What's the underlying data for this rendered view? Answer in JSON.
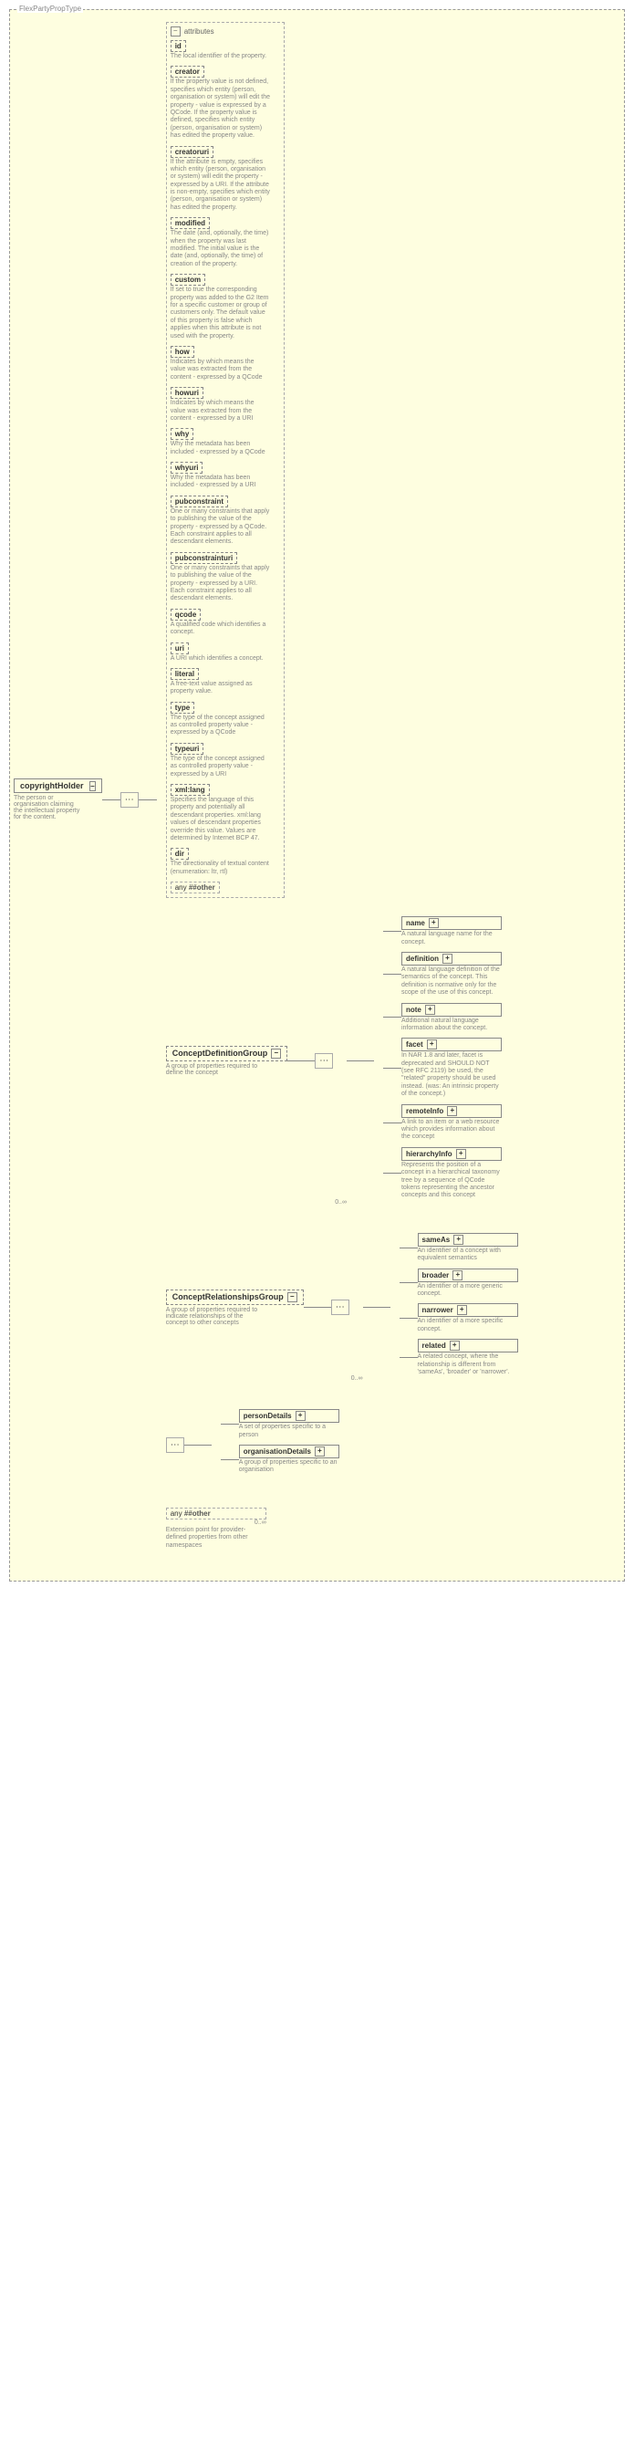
{
  "type_name": "FlexPartyPropType",
  "root": {
    "name": "copyrightHolder",
    "desc": "The person or organisation claiming the intellectual property for the content."
  },
  "attributes_label": "attributes",
  "attributes": [
    {
      "name": "id",
      "desc": "The local identifier of the property."
    },
    {
      "name": "creator",
      "desc": "If the property value is not defined, specifies which entity (person, organisation or system) will edit the property - value is expressed by a QCode. If the property value is defined, specifies which entity (person, organisation or system) has edited the property value."
    },
    {
      "name": "creatoruri",
      "desc": "If the attribute is empty, specifies which entity (person, organisation or system) will edit the property - expressed by a URI. If the attribute is non-empty, specifies which entity (person, organisation or system) has edited the property."
    },
    {
      "name": "modified",
      "desc": "The date (and, optionally, the time) when the property was last modified. The initial value is the date (and, optionally, the time) of creation of the property."
    },
    {
      "name": "custom",
      "desc": "If set to true the corresponding property was added to the G2 Item for a specific customer or group of customers only. The default value of this property is false which applies when this attribute is not used with the property."
    },
    {
      "name": "how",
      "desc": "Indicates by which means the value was extracted from the content - expressed by a QCode"
    },
    {
      "name": "howuri",
      "desc": "Indicates by which means the value was extracted from the content - expressed by a URI"
    },
    {
      "name": "why",
      "desc": "Why the metadata has been included - expressed by a QCode"
    },
    {
      "name": "whyuri",
      "desc": "Why the metadata has been included - expressed by a URI"
    },
    {
      "name": "pubconstraint",
      "desc": "One or many constraints that apply to publishing the value of the property - expressed by a QCode. Each constraint applies to all descendant elements."
    },
    {
      "name": "pubconstrainturi",
      "desc": "One or many constraints that apply to publishing the value of the property - expressed by a URI. Each constraint applies to all descendant elements."
    },
    {
      "name": "qcode",
      "desc": "A qualified code which identifies a concept."
    },
    {
      "name": "uri",
      "desc": "A URI which identifies a concept."
    },
    {
      "name": "literal",
      "desc": "A free-text value assigned as property value."
    },
    {
      "name": "type",
      "desc": "The type of the concept assigned as controlled property value - expressed by a QCode"
    },
    {
      "name": "typeuri",
      "desc": "The type of the concept assigned as controlled property value - expressed by a URI"
    },
    {
      "name": "xml:lang",
      "desc": "Specifies the language of this property and potentially all descendant properties. xml:lang values of descendant properties override this value. Values are determined by Internet BCP 47."
    },
    {
      "name": "dir",
      "desc": "The directionality of textual content (enumeration: ltr, rtl)"
    }
  ],
  "any_attr": "##other",
  "concept_def": {
    "name": "ConceptDefinitionGroup",
    "desc": "A group of properties required to define the concept",
    "card": "0..∞",
    "children": [
      {
        "name": "name",
        "desc": "A natural language name for the concept."
      },
      {
        "name": "definition",
        "desc": "A natural language definition of the semantics of the concept. This definition is normative only for the scope of the use of this concept."
      },
      {
        "name": "note",
        "desc": "Additional natural language information about the concept."
      },
      {
        "name": "facet",
        "desc": "In NAR 1.8 and later, facet is deprecated and SHOULD NOT (see RFC 2119) be used, the \"related\" property should be used instead. (was: An intrinsic property of the concept.)"
      },
      {
        "name": "remoteInfo",
        "desc": "A link to an item or a web resource which provides information about the concept"
      },
      {
        "name": "hierarchyInfo",
        "desc": "Represents the position of a concept in a hierarchical taxonomy tree by a sequence of QCode tokens representing the ancestor concepts and this concept"
      }
    ]
  },
  "concept_rel": {
    "name": "ConceptRelationshipsGroup",
    "desc": "A group of properties required to indicate relationships of the concept to other concepts",
    "card": "0..∞",
    "children": [
      {
        "name": "sameAs",
        "desc": "An identifier of a concept with equivalent semantics"
      },
      {
        "name": "broader",
        "desc": "An identifier of a more generic concept."
      },
      {
        "name": "narrower",
        "desc": "An identifier of a more specific concept."
      },
      {
        "name": "related",
        "desc": "A related concept, where the relationship is different from 'sameAs', 'broader' or 'narrower'."
      }
    ]
  },
  "details_children": [
    {
      "name": "personDetails",
      "desc": "A set of properties specific to a person"
    },
    {
      "name": "organisationDetails",
      "desc": "A group of properties specific to an organisation"
    }
  ],
  "bottom_any": {
    "label": "##other",
    "card": "0..∞",
    "desc": "Extension point for provider-defined properties from other namespaces"
  },
  "any_prefix": "any"
}
